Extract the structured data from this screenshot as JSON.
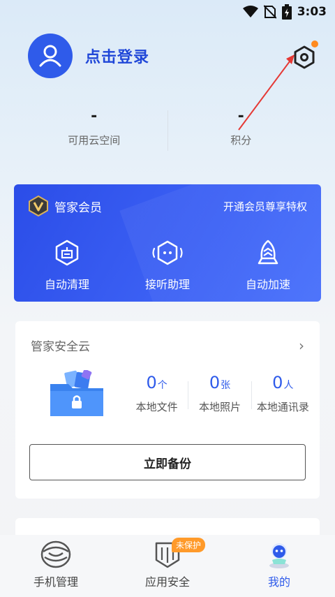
{
  "status_bar": {
    "time": "3:03"
  },
  "profile": {
    "login_label": "点击登录"
  },
  "stats": [
    {
      "value": "-",
      "label": "可用云空间"
    },
    {
      "value": "-",
      "label": "积分"
    }
  ],
  "vip": {
    "title": "管家会员",
    "promo": "开通会员尊享特权",
    "features": [
      {
        "label": "自动清理",
        "icon": "auto-clean-icon"
      },
      {
        "label": "接听助理",
        "icon": "call-assistant-icon"
      },
      {
        "label": "自动加速",
        "icon": "auto-boost-icon"
      }
    ]
  },
  "cloud": {
    "title": "管家安全云",
    "stats": [
      {
        "num": "0",
        "unit": "个",
        "label": "本地文件"
      },
      {
        "num": "0",
        "unit": "张",
        "label": "本地照片"
      },
      {
        "num": "0",
        "unit": "人",
        "label": "本地通讯录"
      }
    ],
    "backup_label": "立即备份"
  },
  "nav": {
    "items": [
      {
        "label": "手机管理",
        "icon": "phone-manage-icon"
      },
      {
        "label": "应用安全",
        "icon": "app-security-icon",
        "badge": "未保护"
      },
      {
        "label": "我的",
        "icon": "my-profile-icon"
      }
    ]
  },
  "colors": {
    "brand_blue": "#2f5bea",
    "badge_orange": "#ff9a2a",
    "annotation_red": "#e53935"
  }
}
